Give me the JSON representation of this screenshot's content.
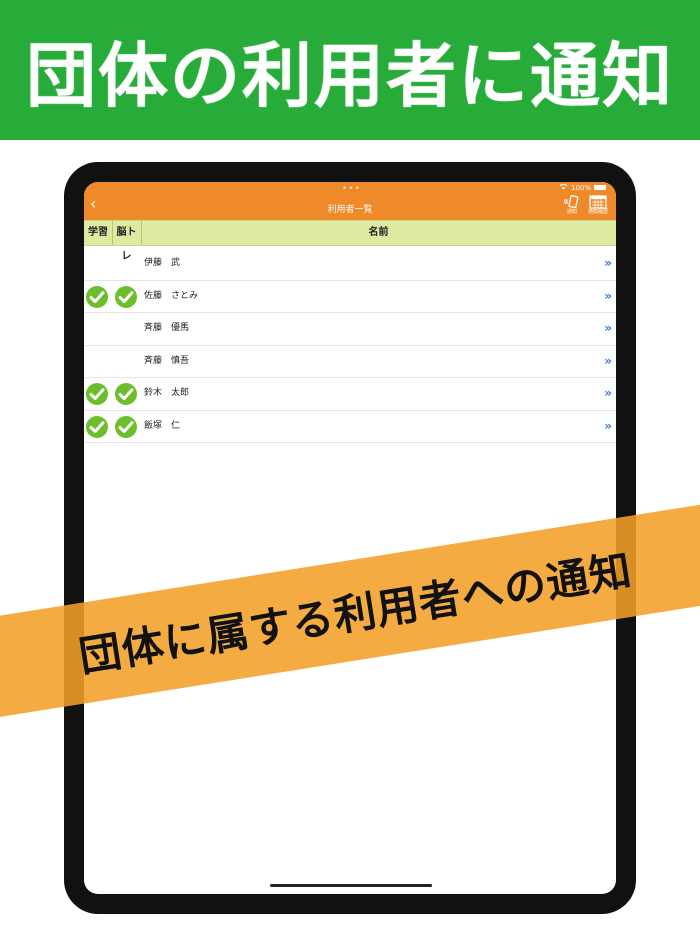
{
  "banner": {
    "title": "団体の利用者に通知"
  },
  "status_bar": {
    "battery": "100%"
  },
  "header": {
    "title": "利用者一覧",
    "back_icon": "chevron-left-icon",
    "notify_label": "通知",
    "history_label": "通知履歴"
  },
  "table": {
    "headers": {
      "study": "学習",
      "brain": "脳トレ",
      "name": "名前"
    },
    "rows": [
      {
        "name": "伊藤　武",
        "study": false,
        "brain": false
      },
      {
        "name": "佐藤　さとみ",
        "study": true,
        "brain": true
      },
      {
        "name": "斉藤　優馬",
        "study": false,
        "brain": false
      },
      {
        "name": "斉藤　慎吾",
        "study": false,
        "brain": false
      },
      {
        "name": "鈴木　太郎",
        "study": true,
        "brain": true
      },
      {
        "name": "飯塚　仁",
        "study": true,
        "brain": true
      }
    ]
  },
  "ribbon": {
    "text": "団体に属する利用者への通知"
  },
  "colors": {
    "banner": "#27ac3a",
    "header": "#ef8a2b",
    "table_header": "#dfe9a2",
    "check": "#6cbf2a",
    "chevron": "#3a7bd5",
    "ribbon": "#f3a028"
  }
}
